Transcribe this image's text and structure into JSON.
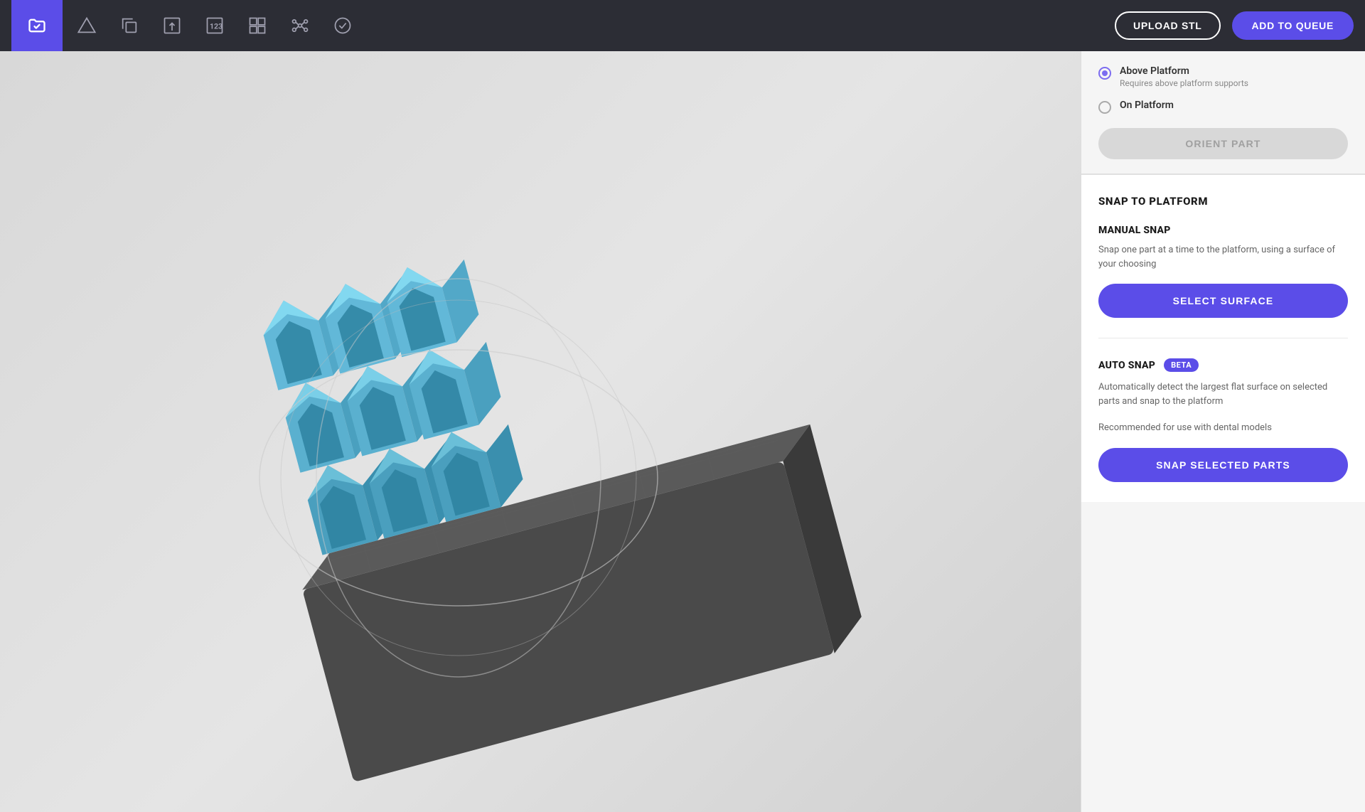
{
  "header": {
    "upload_btn": "UPLOAD STL",
    "queue_btn": "ADD TO QUEUE",
    "icons": [
      {
        "name": "folder-icon",
        "label": "Folder"
      },
      {
        "name": "shape-icon",
        "label": "Shape"
      },
      {
        "name": "duplicate-icon",
        "label": "Duplicate"
      },
      {
        "name": "export-icon",
        "label": "Export"
      },
      {
        "name": "number-icon",
        "label": "Number"
      },
      {
        "name": "grid-icon",
        "label": "Grid"
      },
      {
        "name": "nodes-icon",
        "label": "Nodes"
      },
      {
        "name": "check-icon",
        "label": "Check"
      }
    ]
  },
  "placement": {
    "above_platform": {
      "title": "Above Platform",
      "subtitle": "Requires above platform supports",
      "selected": true
    },
    "on_platform": {
      "title": "On Platform",
      "selected": false
    },
    "orient_btn": "ORIENT PART"
  },
  "snap_to_platform": {
    "section_title": "SNAP TO PLATFORM",
    "manual_snap": {
      "title": "MANUAL SNAP",
      "description": "Snap one part at a time to the platform, using a surface of your choosing",
      "btn_label": "SELECT SURFACE"
    },
    "auto_snap": {
      "title": "AUTO SNAP",
      "beta_label": "BETA",
      "description1": "Automatically detect the largest flat surface on selected parts and snap to the platform",
      "description2": "Recommended for use with dental models",
      "btn_label": "SNAP SELECTED PARTS"
    }
  }
}
